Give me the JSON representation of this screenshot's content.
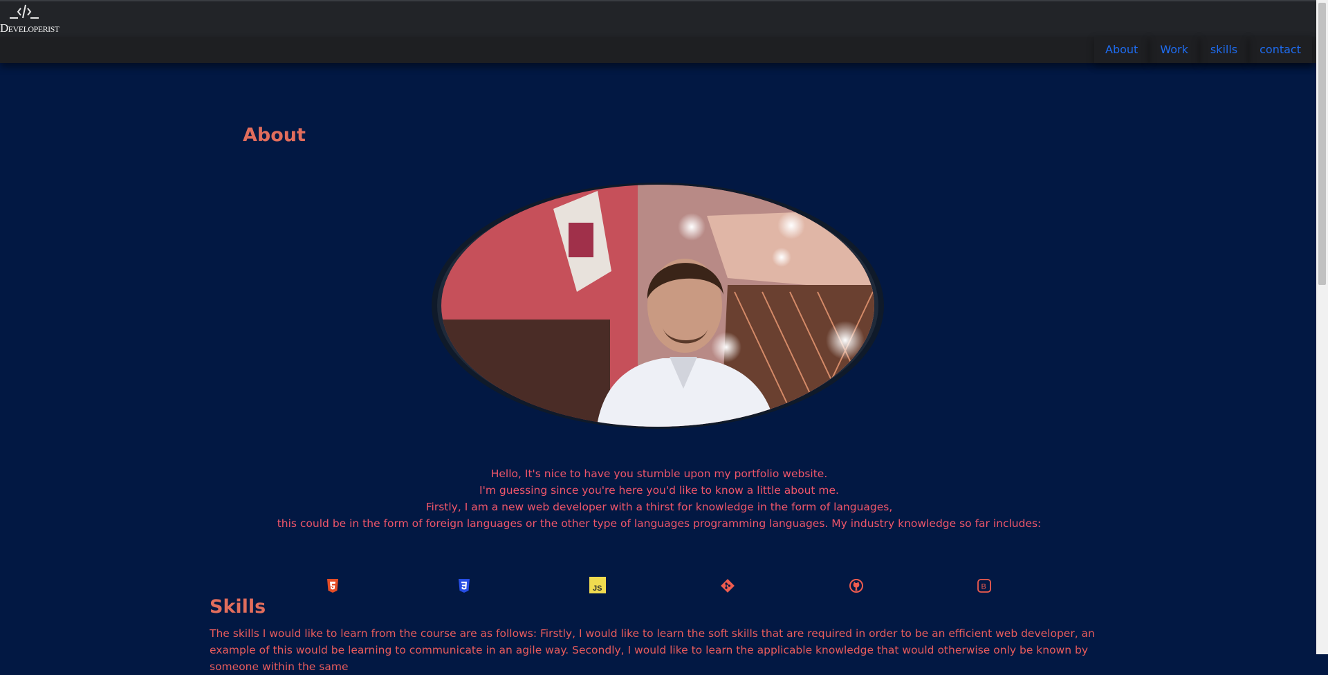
{
  "header": {
    "logo_text": "Developerist",
    "logo_icon": "code-brackets-icon"
  },
  "nav": {
    "links": [
      "About",
      "Work",
      "skills",
      "contact"
    ]
  },
  "about": {
    "title": "About",
    "lines": [
      "Hello, It's nice to have you stumble upon my portfolio website.",
      "I'm guessing since you're here you'd like to know a little about me.",
      "Firstly, I am a new web developer with a thirst for knowledge in the form of languages,",
      "this could be in the form of foreign languages or the other type of languages programming languages. My industry knowledge so far includes:"
    ]
  },
  "skill_icons": [
    "html5-icon",
    "css3-icon",
    "javascript-icon",
    "git-icon",
    "github-icon",
    "bootstrap-icon"
  ],
  "skills": {
    "title": "Skills",
    "text": "The skills I would like to learn from the course are as follows: Firstly, I would like to learn the soft skills that are required in order to be an efficient web developer, an example of this would be learning to communicate in an agile way. Secondly, I would like to learn the applicable knowledge that would otherwise only be known by someone within the same"
  },
  "colors": {
    "background": "#021843",
    "accent": "#e16d5c",
    "nav_link": "#1e6cf0",
    "topbar": "#222428"
  }
}
